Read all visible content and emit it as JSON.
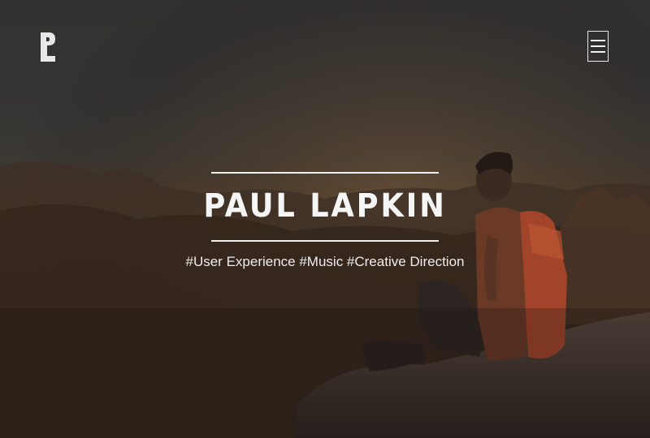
{
  "colors": {
    "text": "#f5f5f5",
    "sky_top": "#323232",
    "horizon_glow": "#4a3a2a",
    "ground": "#1d1714",
    "backpack": "#a2442a"
  },
  "header": {
    "logo_icon": "p-logo-icon",
    "menu_icon": "hamburger-menu-icon"
  },
  "hero": {
    "name": "PAUL LAPKIN",
    "tagline": "#User Experience #Music #Creative Direction"
  }
}
